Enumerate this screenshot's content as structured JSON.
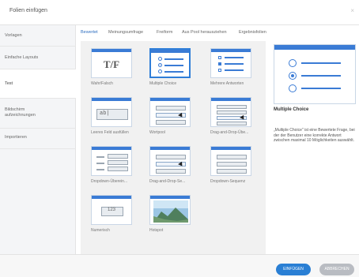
{
  "dialog": {
    "title": "Folien einfügen",
    "close_glyph": "×"
  },
  "sidebar": {
    "items": [
      {
        "label": "Vorlagen"
      },
      {
        "label": "Einfache Layouts"
      },
      {
        "label": "Test",
        "active": true
      },
      {
        "label": "Bildschirm aufzeichnungen"
      },
      {
        "label": "Importieren"
      }
    ]
  },
  "tabs": [
    {
      "label": "Bewertet",
      "active": true
    },
    {
      "label": "Meinungsumfrage"
    },
    {
      "label": "Freiform"
    },
    {
      "label": "Aus Pool herausziehen"
    },
    {
      "label": "Ergebnisfolien"
    }
  ],
  "tiles": [
    {
      "label": "Wahr/Falsch",
      "icon": "true-false-icon",
      "text": "T/F"
    },
    {
      "label": "Multiple Choice",
      "icon": "multiple-choice-icon",
      "selected": true
    },
    {
      "label": "Mehrere Antworten",
      "icon": "multiple-response-icon"
    },
    {
      "label": "Leeres Feld ausfüllen",
      "icon": "fill-in-blank-icon",
      "text": "ab|"
    },
    {
      "label": "Wortpool",
      "icon": "word-bank-icon"
    },
    {
      "label": "Drag-and-Drop-Übe...",
      "icon": "drag-drop-icon"
    },
    {
      "label": "Dropdown-Überein...",
      "icon": "dropdown-matching-icon"
    },
    {
      "label": "Drag-and-Drop-Se...",
      "icon": "drag-drop-sequence-icon"
    },
    {
      "label": "Dropdown-Sequenz",
      "icon": "dropdown-sequence-icon"
    },
    {
      "label": "Numerisch",
      "icon": "numeric-icon",
      "text": "123"
    },
    {
      "label": "Hotspot",
      "icon": "hotspot-icon"
    }
  ],
  "preview": {
    "title": "Multiple Choice",
    "description": "„Multiple Choice\" ist eine Bewertete Frage, bei der der Benutzer eine korrekte Antwort zwischen maximal 10 Möglichkeiten auswählt."
  },
  "footer": {
    "insert_label": "EINFÜGEN",
    "cancel_label": "ABBRECHEN"
  },
  "colors": {
    "accent": "#2a7fd4",
    "tile_bar": "#3a7bd5",
    "sidebar_bg": "#f4f5f7"
  }
}
